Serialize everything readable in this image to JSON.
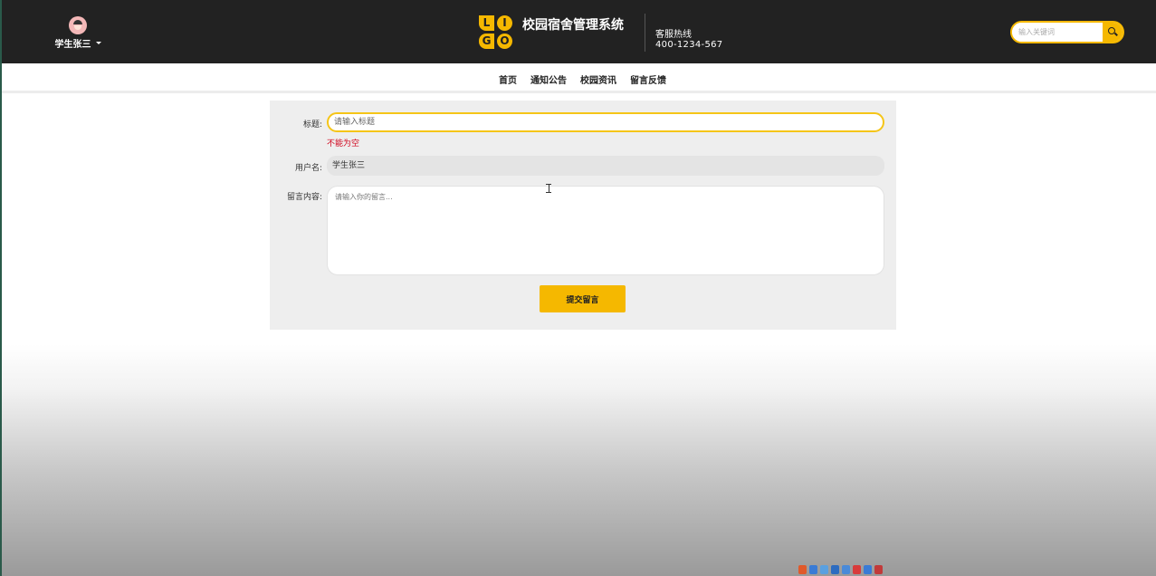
{
  "header": {
    "user_name": "学生张三",
    "site_title": "校园宿舍管理系统",
    "logo_letters": [
      "L",
      "I",
      "G",
      "O"
    ],
    "hotline_label": "客服热线",
    "hotline_phone": "400-1234-567",
    "search_placeholder": "输入关键词"
  },
  "nav": {
    "items": [
      {
        "label": "首页"
      },
      {
        "label": "通知公告"
      },
      {
        "label": "校园资讯"
      },
      {
        "label": "留言反馈"
      }
    ]
  },
  "form": {
    "title_label": "标题:",
    "title_value": "",
    "title_placeholder": "请输入标题",
    "title_error": "不能为空",
    "username_label": "用户名:",
    "username_value": "学生张三",
    "content_label": "留言内容:",
    "content_value": "",
    "content_placeholder": "请输入你的留言...",
    "submit_label": "提交留言"
  },
  "colors": {
    "accent": "#f5b800",
    "header_bg": "#222222",
    "error": "#d0021b",
    "panel_bg": "#eeeeee"
  }
}
